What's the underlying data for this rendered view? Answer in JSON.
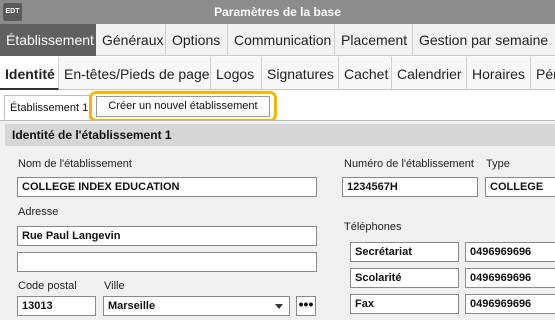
{
  "window": {
    "icon_text": "EDT",
    "title": "Paramètres de la base"
  },
  "main_tabs": [
    {
      "label": "Établissement"
    },
    {
      "label": "Généraux"
    },
    {
      "label": "Options"
    },
    {
      "label": "Communication"
    },
    {
      "label": "Placement"
    },
    {
      "label": "Gestion par semaine"
    }
  ],
  "sub_tabs": [
    {
      "label": "Identité"
    },
    {
      "label": "En-têtes/Pieds de page"
    },
    {
      "label": "Logos"
    },
    {
      "label": "Signatures"
    },
    {
      "label": "Cachet"
    },
    {
      "label": "Calendrier"
    },
    {
      "label": "Horaires"
    },
    {
      "label": "Pér"
    }
  ],
  "establishment_tab": {
    "label": "Établissement 1"
  },
  "create_button": {
    "label": "Créer un nouvel établissement"
  },
  "section": {
    "title": "Identité de l'établissement 1"
  },
  "form": {
    "name_label": "Nom de l'établissement",
    "name_value": "COLLEGE INDEX EDUCATION",
    "address_label": "Adresse",
    "address_line1": "Rue Paul Langevin",
    "address_line2": "",
    "postal_label": "Code postal",
    "postal_value": "13013",
    "city_label": "Ville",
    "city_value": "Marseille",
    "number_label": "Numéro de l'établissement",
    "number_value": "1234567H",
    "type_label": "Type",
    "type_value": "COLLEGE",
    "phones_label": "Téléphones",
    "phones": [
      {
        "label": "Secrétariat",
        "number": "0496969696"
      },
      {
        "label": "Scolarité",
        "number": "0496969696"
      },
      {
        "label": "Fax",
        "number": "0496969696"
      }
    ],
    "more_button": "•••"
  }
}
